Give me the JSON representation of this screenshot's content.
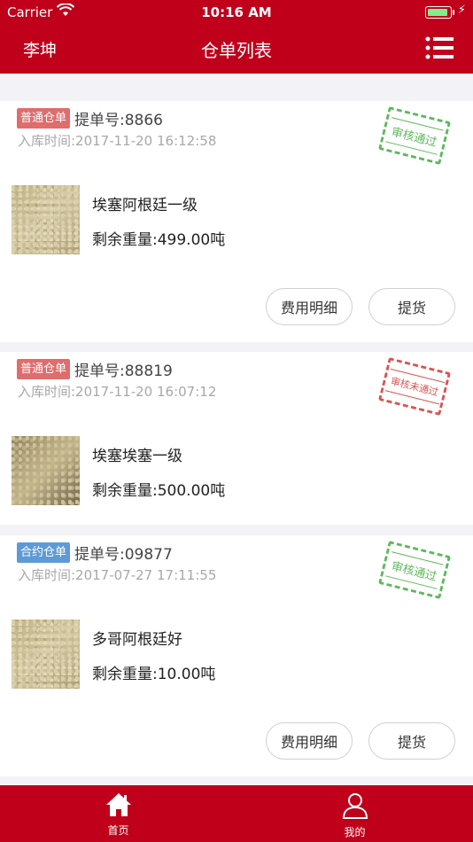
{
  "status_bar": {
    "carrier": "Carrier",
    "time": "10:16 AM",
    "battery_level": 0.85
  },
  "nav": {
    "user_name": "李坤",
    "title": "仓单列表",
    "menu_icon": "list-menu-icon"
  },
  "orders": [
    {
      "type_tag": "普通仓单",
      "bill_no": "提单号:8866",
      "in_time": "入库时间:2017-11-20 16:12:58",
      "stamp": "审核通过",
      "stamp_status": "approved",
      "product_name": "埃塞阿根廷一级",
      "remaining_weight": "剩余重量:499.00吨",
      "fee_detail_label": "费用明细",
      "pickup_label": "提货"
    },
    {
      "type_tag": "普通仓单",
      "bill_no": "提单号:88819",
      "in_time": "入库时间:2017-11-20 16:07:12",
      "stamp": "审核未通过",
      "stamp_status": "rejected",
      "product_name": "埃塞埃塞一级",
      "remaining_weight": "剩余重量:500.00吨"
    },
    {
      "type_tag": "合约仓单",
      "bill_no": "提单号:09877",
      "in_time": "入库时间:2017-07-27 17:11:55",
      "stamp": "审核通过",
      "stamp_status": "approved",
      "product_name": "多哥阿根廷好",
      "remaining_weight": "剩余重量:10.00吨",
      "fee_detail_label": "费用明细",
      "pickup_label": "提货"
    }
  ],
  "tab_bar": {
    "items": [
      {
        "label": "首页",
        "icon": "home-icon"
      },
      {
        "label": "我的",
        "icon": "user-icon"
      }
    ]
  },
  "colors": {
    "brand_red": "#c0001b",
    "tag_red": "#e06c6c",
    "tag_blue": "#5d9ad6",
    "stamp_green": "#5db85c",
    "stamp_red": "#d9534f"
  }
}
